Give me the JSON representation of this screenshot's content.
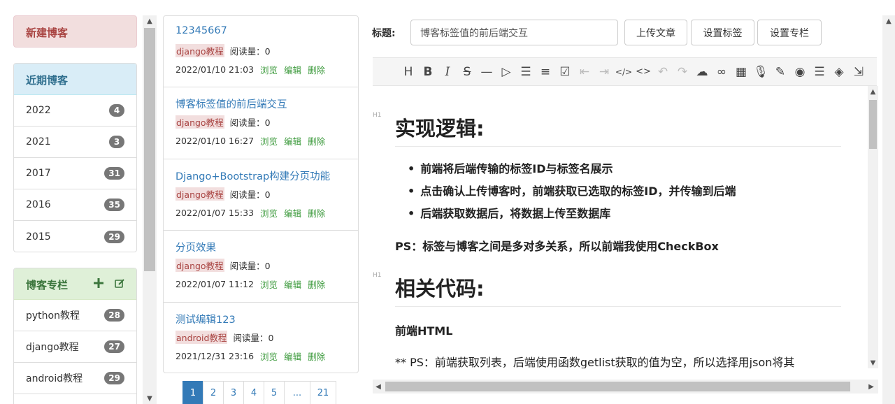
{
  "sidebar": {
    "new_blog": "新建博客",
    "recent_title": "近期博客",
    "recent": [
      {
        "label": "2022",
        "count": "4"
      },
      {
        "label": "2021",
        "count": "3"
      },
      {
        "label": "2017",
        "count": "31"
      },
      {
        "label": "2016",
        "count": "35"
      },
      {
        "label": "2015",
        "count": "29"
      }
    ],
    "columns_title": "博客专栏",
    "columns": [
      {
        "label": "python教程",
        "count": "28"
      },
      {
        "label": "django教程",
        "count": "27"
      },
      {
        "label": "android教程",
        "count": "29"
      }
    ]
  },
  "posts": [
    {
      "title": "12345667",
      "category": "django教程",
      "reads": "阅读量：0",
      "date": "2022/01/10 21:03"
    },
    {
      "title": "博客标签值的前后端交互",
      "category": "django教程",
      "reads": "阅读量：0",
      "date": "2022/01/10 16:27"
    },
    {
      "title": "Django+Bootstrap构建分页功能",
      "category": "django教程",
      "reads": "阅读量：0",
      "date": "2022/01/07 15:33"
    },
    {
      "title": "分页效果",
      "category": "django教程",
      "reads": "阅读量：0",
      "date": "2022/01/07 11:12"
    },
    {
      "title": "测试编辑123",
      "category": "android教程",
      "reads": "阅读量：0",
      "date": "2021/12/31 23:16"
    }
  ],
  "post_actions": {
    "view": "浏览",
    "edit": "编辑",
    "delete": "删除"
  },
  "pagination": [
    "1",
    "2",
    "3",
    "4",
    "5",
    "...",
    "21"
  ],
  "editor": {
    "title_label": "标题:",
    "title_value": "博客标签值的前后端交互",
    "upload_btn": "上传文章",
    "tags_btn": "设置标签",
    "column_btn": "设置专栏",
    "heading_tag": "H1",
    "h1_a": "实现逻辑:",
    "list": [
      "前端将后端传输的标签ID与标签名展示",
      "点击确认上传博客时，前端获取已选取的标签ID，并传输到后端",
      "后端获取数据后，将数据上传至数据库"
    ],
    "ps": "PS：标签与博客之间是多对多关系，所以前端我使用CheckBox",
    "h1_b": "相关代码:",
    "sub": "前端HTML",
    "note": "** PS：前端获取列表，后端使用函数getlist获取的值为空，所以选择用json将其"
  }
}
